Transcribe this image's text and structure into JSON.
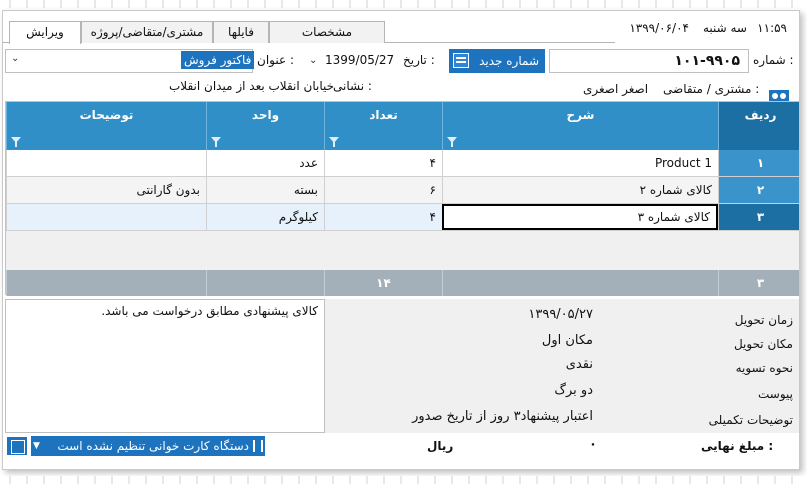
{
  "status": {
    "time": "۱۱:۵۹",
    "day": "سه شنبه",
    "date": "۱۳۹۹/۰۶/۰۴"
  },
  "tabs": [
    {
      "label": "ویرایش",
      "active": true
    },
    {
      "label": "مشتری/متقاضی/پروژه",
      "active": false
    },
    {
      "label": "فایلها",
      "active": false
    },
    {
      "label": "مشخصات",
      "active": false
    }
  ],
  "header": {
    "number_label": "شماره :",
    "number_value": "۱۰۱-۹۹۰۵",
    "new_number_label": "شماره جدید",
    "date_label": "تاریخ :",
    "date_value": "1399/05/27",
    "title_label": "عنوان :",
    "title_value": "فاکتور فروش",
    "customer_label": "مشتری / متقاضی :",
    "customer_value": "اصغر اصغری",
    "address_label": "نشانی :",
    "address_value": "خیابان انقلاب بعد از میدان انقلاب"
  },
  "grid": {
    "columns": [
      "ردیف",
      "شرح",
      "تعداد",
      "واحد",
      "توضیحات"
    ],
    "rows": [
      {
        "no": "۱",
        "desc": "Product 1",
        "qty": "۴",
        "unit": "عدد",
        "notes": ""
      },
      {
        "no": "۲",
        "desc": "کالای شماره ۲",
        "qty": "۶",
        "unit": "بسته",
        "notes": "بدون گارانتی"
      },
      {
        "no": "۳",
        "desc": "کالای شماره ۳",
        "qty": "۴",
        "unit": "کیلوگرم",
        "notes": ""
      }
    ],
    "footer": {
      "count": "۳",
      "qty_total": "۱۴"
    }
  },
  "notes": "کالای پیشنهادی مطابق درخواست می باشد.",
  "info": [
    {
      "label": "زمان تحویل",
      "value": "۱۳۹۹/۰۵/۲۷"
    },
    {
      "label": "مکان تحویل",
      "value": "مکان اول"
    },
    {
      "label": "نحوه تسویه",
      "value": "نقدی"
    },
    {
      "label": "پیوست",
      "value": "دو برگ"
    },
    {
      "label": "توضیحات تکمیلی",
      "value": "اعتبار پیشنهاد۳ روز از تاریخ صدور"
    }
  ],
  "footer": {
    "card_reader": "دستگاه کارت خوانی تنظیم نشده است",
    "final_label": "مبلغ نهایی :",
    "amount": "۰",
    "currency": "ریال"
  },
  "colors": {
    "accent": "#1e73be",
    "header": "#2f8fc6",
    "footer_row": "#a3b0b9"
  }
}
